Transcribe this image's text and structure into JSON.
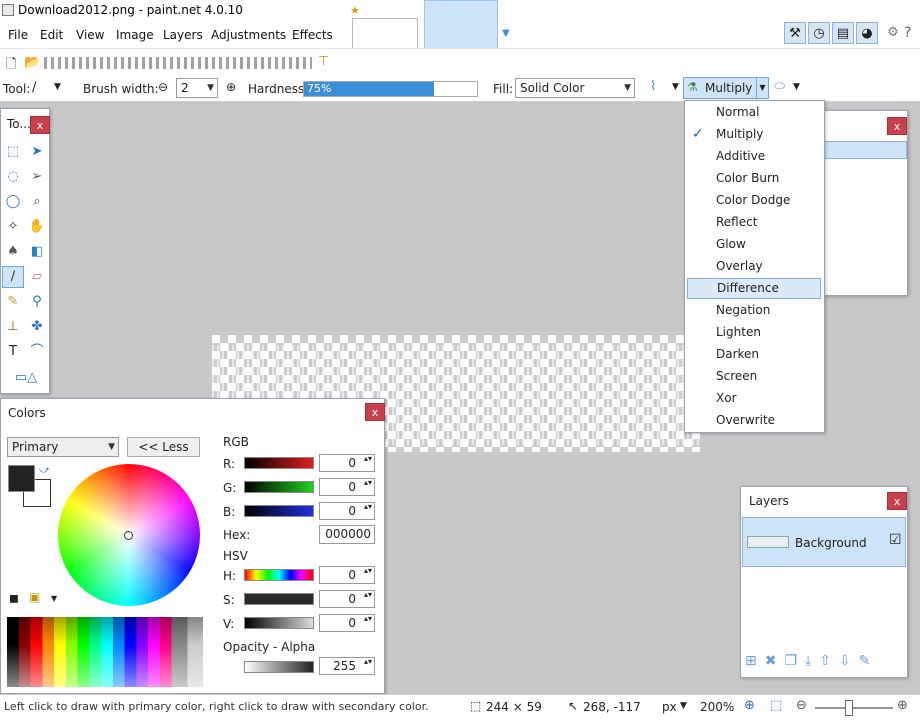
{
  "window": {
    "title": "Download2012.png - paint.net 4.0.10"
  },
  "menu": [
    "File",
    "Edit",
    "View",
    "Image",
    "Layers",
    "Adjustments",
    "Effects"
  ],
  "toolbar": {
    "tool_label": "Tool:",
    "brush_width_label": "Brush width:",
    "brush_width_value": "2",
    "hardness_label": "Hardness:",
    "hardness_value": "75%",
    "hardness_percent": 75,
    "fill_label": "Fill:",
    "fill_value": "Solid Color",
    "blend_mode_value": "Multiply"
  },
  "blend_menu": {
    "items": [
      "Normal",
      "Multiply",
      "Additive",
      "Color Burn",
      "Color Dodge",
      "Reflect",
      "Glow",
      "Overlay",
      "Difference",
      "Negation",
      "Lighten",
      "Darken",
      "Screen",
      "Xor",
      "Overwrite"
    ],
    "checked": "Multiply",
    "highlighted": "Difference"
  },
  "tools_panel": {
    "title": "To...",
    "close": "x"
  },
  "colors_panel": {
    "title": "Colors",
    "mode_value": "Primary",
    "less_button": "<< Less",
    "close": "x",
    "rgb_label": "RGB",
    "r_label": "R:",
    "r_value": "0",
    "g_label": "G:",
    "g_value": "0",
    "b_label": "B:",
    "b_value": "0",
    "hex_label": "Hex:",
    "hex_value": "000000",
    "hsv_label": "HSV",
    "h_label": "H:",
    "h_value": "0",
    "s_label": "S:",
    "s_value": "0",
    "v_label": "V:",
    "v_value": "0",
    "opacity_label": "Opacity - Alpha",
    "opacity_value": "255"
  },
  "history_panel": {
    "close": "x"
  },
  "layers_panel": {
    "title": "Layers",
    "close": "x",
    "layer_name": "Background"
  },
  "statusbar": {
    "hint": "Left click to draw with primary color, right click to draw with secondary color.",
    "selection_size": "244 × 59",
    "cursor_pos": "268, -117",
    "units": "px",
    "zoom": "200%"
  },
  "colors": {
    "accent": "#3b8fd6",
    "close_red": "#c8414a",
    "highlight": "#dbe9f8"
  }
}
